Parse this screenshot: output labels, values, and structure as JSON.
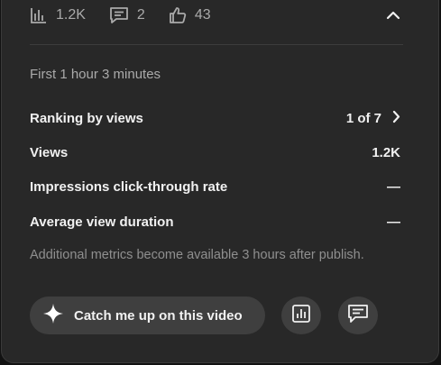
{
  "stats": {
    "views": "1.2K",
    "comments": "2",
    "likes": "43"
  },
  "period": "First 1 hour 3 minutes",
  "metrics": [
    {
      "label": "Ranking by views",
      "value": "1 of 7"
    },
    {
      "label": "Views",
      "value": "1.2K"
    },
    {
      "label": "Impressions click-through rate",
      "value": "—"
    },
    {
      "label": "Average view duration",
      "value": "—"
    }
  ],
  "note": "Additional metrics become available 3 hours after publish.",
  "actions": {
    "catch_up_label": "Catch me up on this video"
  },
  "icons": {
    "views": "bar-chart-icon",
    "comments": "comment-icon",
    "likes": "thumbs-up-icon",
    "collapse": "chevron-up-icon",
    "ranking": "chevron-right-icon",
    "catch_up": "sparkle-icon",
    "analytics": "analytics-icon",
    "comments_button": "comments-icon"
  },
  "colors": {
    "card_background": "#282828",
    "button_background": "#3f3f3f",
    "primary_text": "#f1f1f1",
    "secondary_text": "#aaaaaa"
  }
}
